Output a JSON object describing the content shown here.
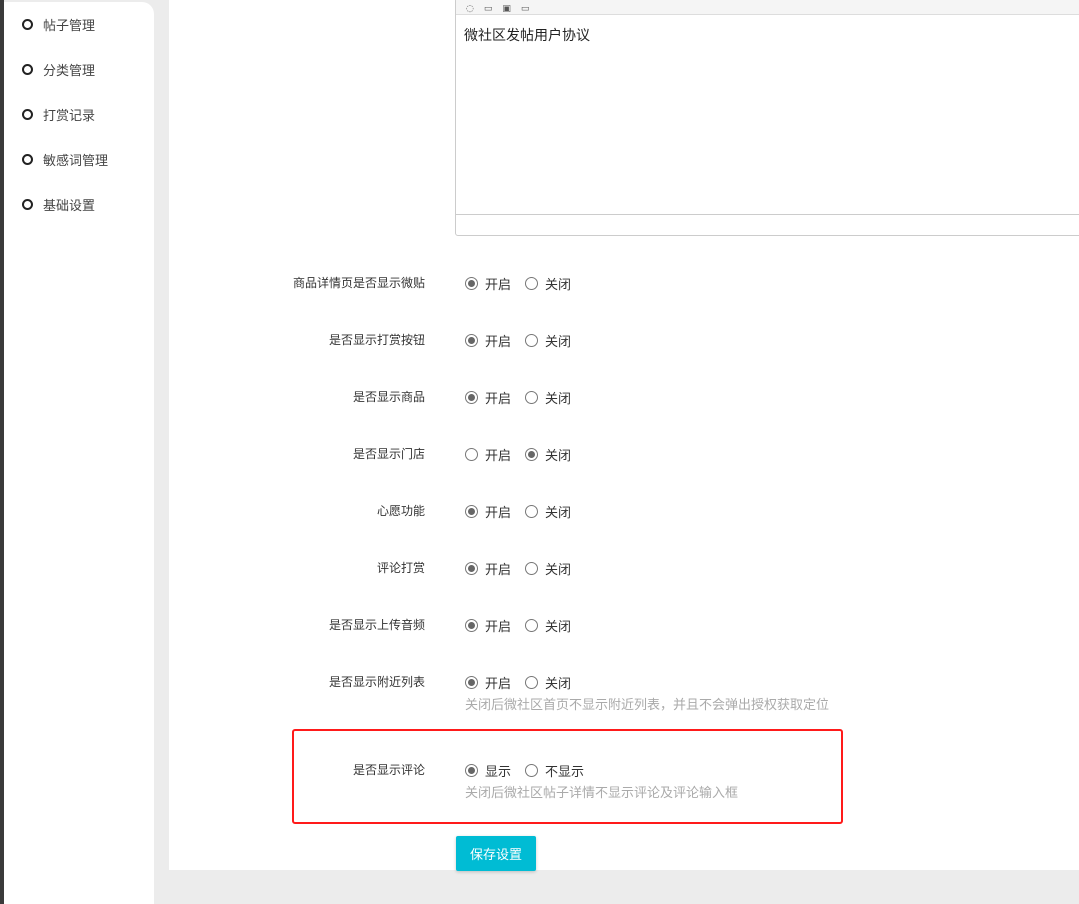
{
  "sidebar": {
    "items": [
      {
        "label": "帖子管理"
      },
      {
        "label": "分类管理"
      },
      {
        "label": "打赏记录"
      },
      {
        "label": "敏感词管理"
      },
      {
        "label": "基础设置"
      }
    ]
  },
  "editor": {
    "content": "微社区发帖用户协议"
  },
  "settings": [
    {
      "label": "商品详情页是否显示微贴",
      "options": [
        "开启",
        "关闭"
      ],
      "selected": 0
    },
    {
      "label": "是否显示打赏按钮",
      "options": [
        "开启",
        "关闭"
      ],
      "selected": 0
    },
    {
      "label": "是否显示商品",
      "options": [
        "开启",
        "关闭"
      ],
      "selected": 0
    },
    {
      "label": "是否显示门店",
      "options": [
        "开启",
        "关闭"
      ],
      "selected": 1
    },
    {
      "label": "心愿功能",
      "options": [
        "开启",
        "关闭"
      ],
      "selected": 0
    },
    {
      "label": "评论打赏",
      "options": [
        "开启",
        "关闭"
      ],
      "selected": 0
    },
    {
      "label": "是否显示上传音频",
      "options": [
        "开启",
        "关闭"
      ],
      "selected": 0
    },
    {
      "label": "是否显示附近列表",
      "options": [
        "开启",
        "关闭"
      ],
      "selected": 0,
      "hint": "关闭后微社区首页不显示附近列表，并且不会弹出授权获取定位"
    },
    {
      "label": "是否显示评论",
      "options": [
        "显示",
        "不显示"
      ],
      "selected": 0,
      "hint": "关闭后微社区帖子详情不显示评论及评论输入框"
    }
  ],
  "save_label": "保存设置",
  "colors": {
    "accent": "#00bcd4",
    "highlight": "#ff1a1a"
  }
}
